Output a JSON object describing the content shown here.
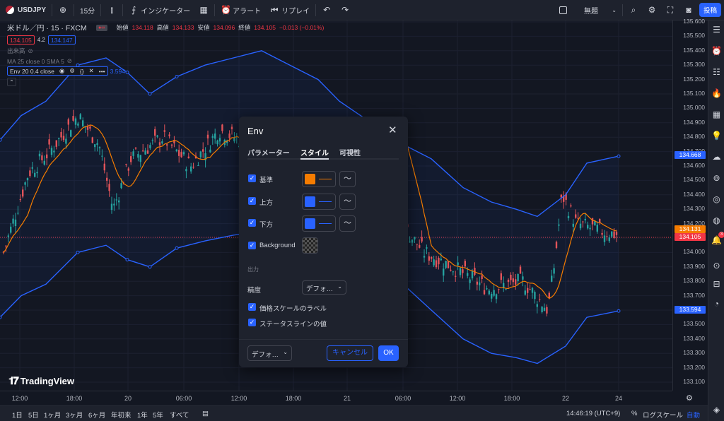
{
  "topbar": {
    "symbol": "USDJPY",
    "interval": "15分",
    "indicators_label": "インジケーター",
    "alert_label": "アラート",
    "replay_label": "リプレイ",
    "layout_name": "無題",
    "publish_label": "投稿"
  },
  "legend": {
    "title": "米ドル／円 · 15 · FXCM",
    "ohlc": {
      "open_label": "始値",
      "open": "134.118",
      "high_label": "高値",
      "high": "134.133",
      "low_label": "安値",
      "low": "134.096",
      "close_label": "終値",
      "close": "134.105",
      "change": "−0.013 (−0.01%)"
    },
    "bid": "134.105",
    "spread": "4.2",
    "ask": "134.147",
    "volume_label": "出来高",
    "ma_label": "MA 25 close 0 SMA 5",
    "env_label": "Env 20 0.4 close",
    "env_value": "3.594"
  },
  "price_axis": {
    "labels": [
      "135.600",
      "135.500",
      "135.400",
      "135.300",
      "135.200",
      "135.100",
      "135.000",
      "134.900",
      "134.800",
      "134.700",
      "134.600",
      "134.500",
      "134.400",
      "134.300",
      "134.200",
      "134.100",
      "134.000",
      "133.900",
      "133.800",
      "133.700",
      "133.600",
      "133.500",
      "133.400",
      "133.300",
      "133.200",
      "133.100"
    ],
    "upper_tag": "134.668",
    "ma_tag": "134.131",
    "price_tag": "134.105",
    "lower_tag": "133.594",
    "colors": {
      "blue": "#2962ff",
      "orange": "#f57c00",
      "red": "#f23645"
    }
  },
  "time_axis": {
    "labels": [
      "12:00",
      "18:00",
      "20",
      "06:00",
      "12:00",
      "18:00",
      "21",
      "06:00",
      "12:00",
      "18:00",
      "22",
      "24"
    ]
  },
  "bottombar": {
    "ranges": [
      "1日",
      "5日",
      "1ヶ月",
      "3ヶ月",
      "6ヶ月",
      "年初来",
      "1年",
      "5年",
      "すべて"
    ],
    "clock": "14:46:19 (UTC+9)",
    "percent": "%",
    "log_label": "ログスケール",
    "auto_label": "自動"
  },
  "watermark": "TradingView",
  "notification_count": "3",
  "dialog": {
    "title": "Env",
    "tabs": [
      "パラメーター",
      "スタイル",
      "可視性"
    ],
    "active_tab": "スタイル",
    "rows": [
      {
        "label": "基準",
        "checked": true,
        "color": "#f57c00"
      },
      {
        "label": "上方",
        "checked": true,
        "color": "#2962ff"
      },
      {
        "label": "下方",
        "checked": true,
        "color": "#2962ff"
      },
      {
        "label": "Background",
        "checked": true,
        "color": "checkered"
      }
    ],
    "output_section": "出力",
    "precision_label": "精度",
    "precision_value": "デフォ…",
    "price_scale_label": "価格スケールのラベル",
    "status_line_label": "ステータスラインの値",
    "defaults_label": "デフォ…",
    "cancel_label": "キャンセル",
    "ok_label": "OK"
  }
}
